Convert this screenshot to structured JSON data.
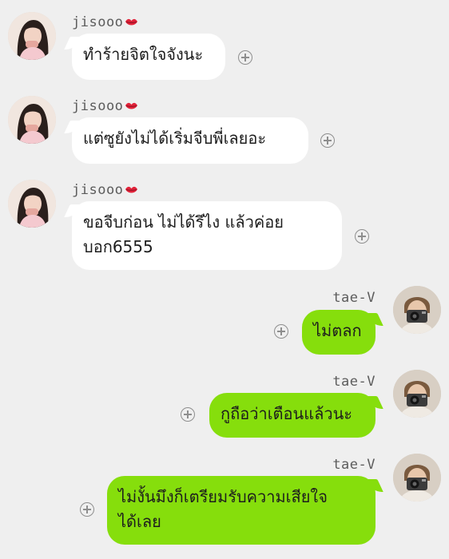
{
  "messages": [
    {
      "sender": "jisooo",
      "text": "ทำร้ายจิตใจจังนะ",
      "lines": [
        "ทำร้ายจิตใจจังนะ"
      ]
    },
    {
      "sender": "jisooo",
      "text": "แต่ซูยังไม่ได้เริ่มจีบพี่เลยอะ",
      "lines": [
        "แต่ซูยังไม่ได้เริ่มจีบพี่เลยอะ"
      ]
    },
    {
      "sender": "jisooo",
      "text": "ขอจีบก่อนไม่ได้รึไง แล้วค่อยบอก6555",
      "lines": [
        "ขอจีบก่อน ไม่ได้รึไง แล้วค่อย",
        "บอก6555"
      ]
    },
    {
      "sender": "tae-V",
      "text": "ไม่ตลก",
      "lines": [
        "ไม่ตลก"
      ]
    },
    {
      "sender": "tae-V",
      "text": "กูถือว่าเตือนแล้วนะ",
      "lines": [
        "กูถือว่าเตือนแล้วนะ"
      ]
    },
    {
      "sender": "tae-V",
      "text": "ไม่งั้นมึงก็เตรียมรับความเสียใจได้เลย",
      "lines": [
        "ไม่งั้นมึงก็เตรียมรับความเสียใจ",
        "ได้เลย"
      ]
    }
  ],
  "icons": {
    "reaction": "plus-circle-icon",
    "emoji": "kiss-lips-icon"
  },
  "colors": {
    "background": "#efefef",
    "incoming_bubble": "#ffffff",
    "outgoing_bubble": "#86de0c",
    "lips": "#e2233a"
  }
}
